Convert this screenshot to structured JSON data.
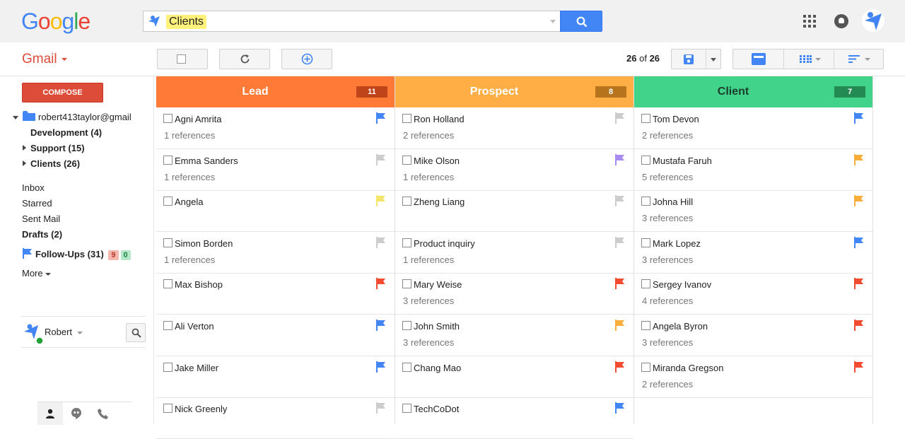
{
  "header": {
    "logo": "Google",
    "search_query": "Clients",
    "icons": [
      "apps-grid-icon",
      "notifications-icon",
      "account-avatar-icon"
    ]
  },
  "toolbar": {
    "app_label": "Gmail",
    "count_current": "26",
    "count_of": "of",
    "count_total": "26"
  },
  "sidebar": {
    "compose_label": "COMPOSE",
    "account": "robert413taylor@gmail",
    "labels": [
      {
        "label": "Development (4)"
      },
      {
        "label": "Support (15)"
      },
      {
        "label": "Clients (26)"
      }
    ],
    "mailboxes": [
      {
        "label": "Inbox"
      },
      {
        "label": "Starred"
      },
      {
        "label": "Sent Mail"
      },
      {
        "label": "Drafts (2)"
      }
    ],
    "followups": {
      "label": "Follow-Ups (31)",
      "red_badge": "9",
      "green_badge": "0"
    },
    "more_label": "More",
    "user_name": "Robert"
  },
  "colors": {
    "lead": "#ff7a36",
    "lead_badge": "#c0441a",
    "prospect": "#ffae46",
    "prospect_badge": "#b7741c",
    "client": "#42d38b",
    "client_badge": "#228a52",
    "flag_blue": "#4285f4",
    "flag_gray": "#cccccc",
    "flag_yellow": "#f5e56b",
    "flag_purple": "#a98cf2",
    "flag_orange": "#f9ae3c",
    "flag_red": "#f24b2f"
  },
  "columns": [
    {
      "title": "Lead",
      "count": "11",
      "cards": [
        {
          "name": "Agni Amrita",
          "refs": "1 references",
          "flag": "blue"
        },
        {
          "name": "Emma Sanders",
          "refs": "1 references",
          "flag": "gray"
        },
        {
          "name": "Angela",
          "refs": "",
          "flag": "yellow"
        },
        {
          "name": "Simon Borden",
          "refs": " 1 references",
          "flag": "gray"
        },
        {
          "name": "Max Bishop",
          "refs": "",
          "flag": "red"
        },
        {
          "name": "Ali Verton",
          "refs": "",
          "flag": "blue"
        },
        {
          "name": "Jake Miller",
          "refs": "",
          "flag": "blue"
        },
        {
          "name": "Nick Greenly",
          "refs": "",
          "flag": "gray"
        }
      ]
    },
    {
      "title": "Prospect",
      "count": "8",
      "cards": [
        {
          "name": "Ron Holland",
          "refs": "2 references",
          "flag": "gray"
        },
        {
          "name": "Mike Olson",
          "refs": "1 references",
          "flag": "purple"
        },
        {
          "name": "Zheng Liang",
          "refs": "",
          "flag": "gray"
        },
        {
          "name": "Product inquiry",
          "refs": "1 references",
          "flag": "gray"
        },
        {
          "name": "Mary Weise",
          "refs": "3 references",
          "flag": "red"
        },
        {
          "name": "John Smith",
          "refs": "3 references",
          "flag": "orange"
        },
        {
          "name": "Chang Mao",
          "refs": "",
          "flag": "red"
        },
        {
          "name": "TechCoDot",
          "refs": "",
          "flag": "blue"
        }
      ]
    },
    {
      "title": "Client",
      "count": "7",
      "cards": [
        {
          "name": "Tom Devon",
          "refs": "2 references",
          "flag": "blue"
        },
        {
          "name": "Mustafa Faruh",
          "refs": "5 references",
          "flag": "orange"
        },
        {
          "name": "Johna Hill",
          "refs": "3 references",
          "flag": "orange"
        },
        {
          "name": "Mark Lopez",
          "refs": "3 references",
          "flag": "blue"
        },
        {
          "name": "Sergey Ivanov",
          "refs": "4 references",
          "flag": "red"
        },
        {
          "name": "Angela Byron",
          "refs": "3 references",
          "flag": "red"
        },
        {
          "name": "Miranda Gregson",
          "refs": "2 references",
          "flag": "red"
        }
      ]
    }
  ]
}
